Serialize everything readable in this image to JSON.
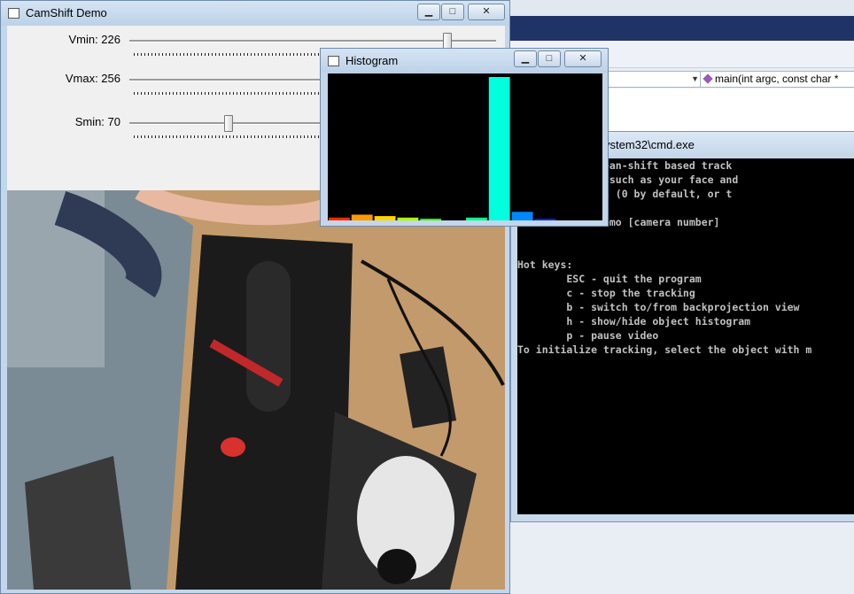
{
  "ide": {
    "function_combo": "main(int argc, const char *"
  },
  "cmd": {
    "title": "ystem32\\cmd.exe",
    "lines": [
      "o that shows mean-shift based track",
      " color objects such as your face and",
      "om video camera (0 by default, or t",
      "",
      "   ./camshiftdemo [camera number]",
      "",
      "",
      "Hot keys:",
      "        ESC - quit the program",
      "        c - stop the tracking",
      "        b - switch to/from backprojection view",
      "        h - show/hide object histogram",
      "        p - pause video",
      "To initialize tracking, select the object with m"
    ]
  },
  "camshift": {
    "title": "CamShift Demo",
    "trackbars": [
      {
        "label": "Vmin: 226",
        "value": 226,
        "max": 256
      },
      {
        "label": "Vmax: 256",
        "value": 256,
        "max": 256
      },
      {
        "label": "Smin: 70",
        "value": 70,
        "max": 256
      }
    ]
  },
  "histogram": {
    "title": "Histogram",
    "bins": [
      {
        "color": "#ff2a00",
        "level": 0.02
      },
      {
        "color": "#ff9900",
        "level": 0.04
      },
      {
        "color": "#ffd500",
        "level": 0.03
      },
      {
        "color": "#aaff00",
        "level": 0.02
      },
      {
        "color": "#33ff00",
        "level": 0.01
      },
      {
        "color": "#00ff33",
        "level": 0.0
      },
      {
        "color": "#00ff88",
        "level": 0.02
      },
      {
        "color": "#00ffdd",
        "level": 1.0
      },
      {
        "color": "#0088ff",
        "level": 0.06
      },
      {
        "color": "#0022ff",
        "level": 0.01
      },
      {
        "color": "#7700ff",
        "level": 0.0
      },
      {
        "color": "#ff00aa",
        "level": 0.0
      }
    ]
  },
  "window_buttons": {
    "minimize": "▁",
    "maximize": "□",
    "close": "✕"
  }
}
